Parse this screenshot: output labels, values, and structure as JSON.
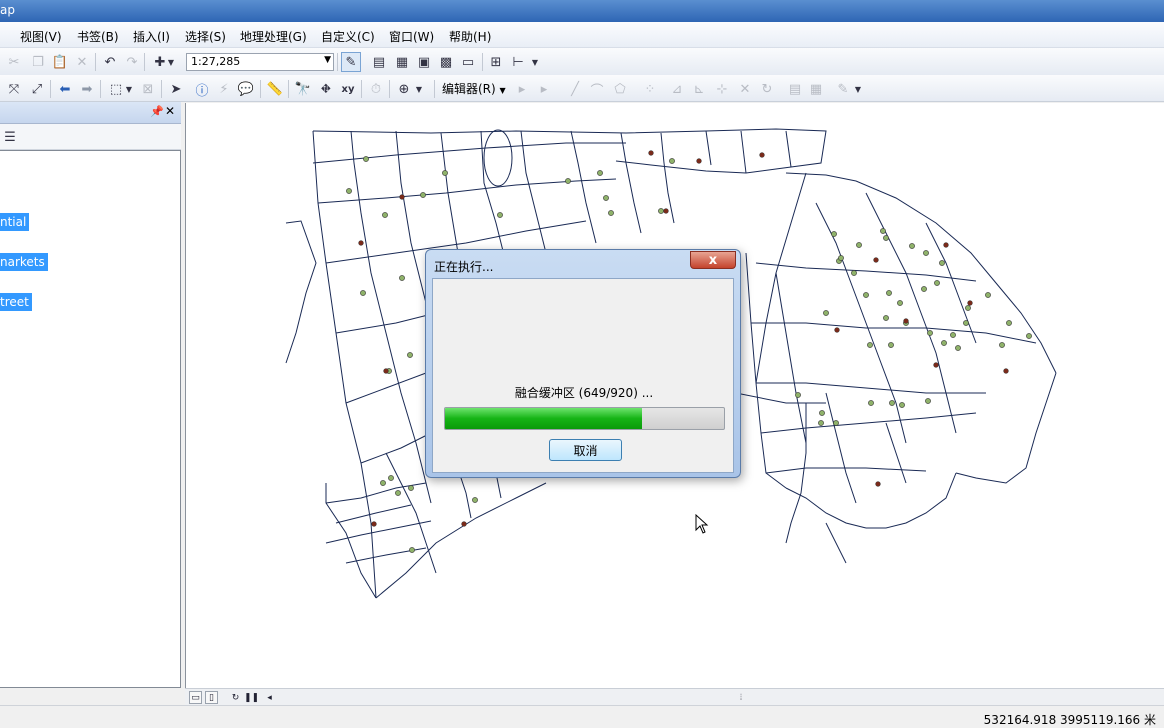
{
  "window": {
    "title": "ap"
  },
  "menu": [
    {
      "label": "视图(V)"
    },
    {
      "label": "书签(B)"
    },
    {
      "label": "插入(I)"
    },
    {
      "label": "选择(S)"
    },
    {
      "label": "地理处理(G)"
    },
    {
      "label": "自定义(C)"
    },
    {
      "label": "窗口(W)"
    },
    {
      "label": "帮助(H)"
    }
  ],
  "toolbar": {
    "scale": "1:27,285",
    "editor_label": "编辑器(R)"
  },
  "toc": {
    "layers": [
      {
        "label": "ntial"
      },
      {
        "label": "narkets"
      },
      {
        "label": "treet"
      }
    ]
  },
  "dialog": {
    "title": "正在执行...",
    "close_label": "x",
    "message": "融合缓冲区 (649/920) ...",
    "progress": 0.705,
    "cancel_label": "取消"
  },
  "status": {
    "coords": "532164.918  3995119.166 米"
  },
  "colors": {
    "selection": "#3399ff",
    "progress": "#16b416",
    "street": "#1a2a55",
    "point_fill": "#8fb26a",
    "node_fill": "#7a2a1a"
  },
  "icons": [
    "cut-icon",
    "copy-icon",
    "paste-icon",
    "delete-icon",
    "undo-icon",
    "redo-icon",
    "add-data-icon",
    "editor-icon",
    "table-icon",
    "zoom-in-icon",
    "identify-icon",
    "find-icon",
    "close-icon",
    "pin-icon"
  ]
}
